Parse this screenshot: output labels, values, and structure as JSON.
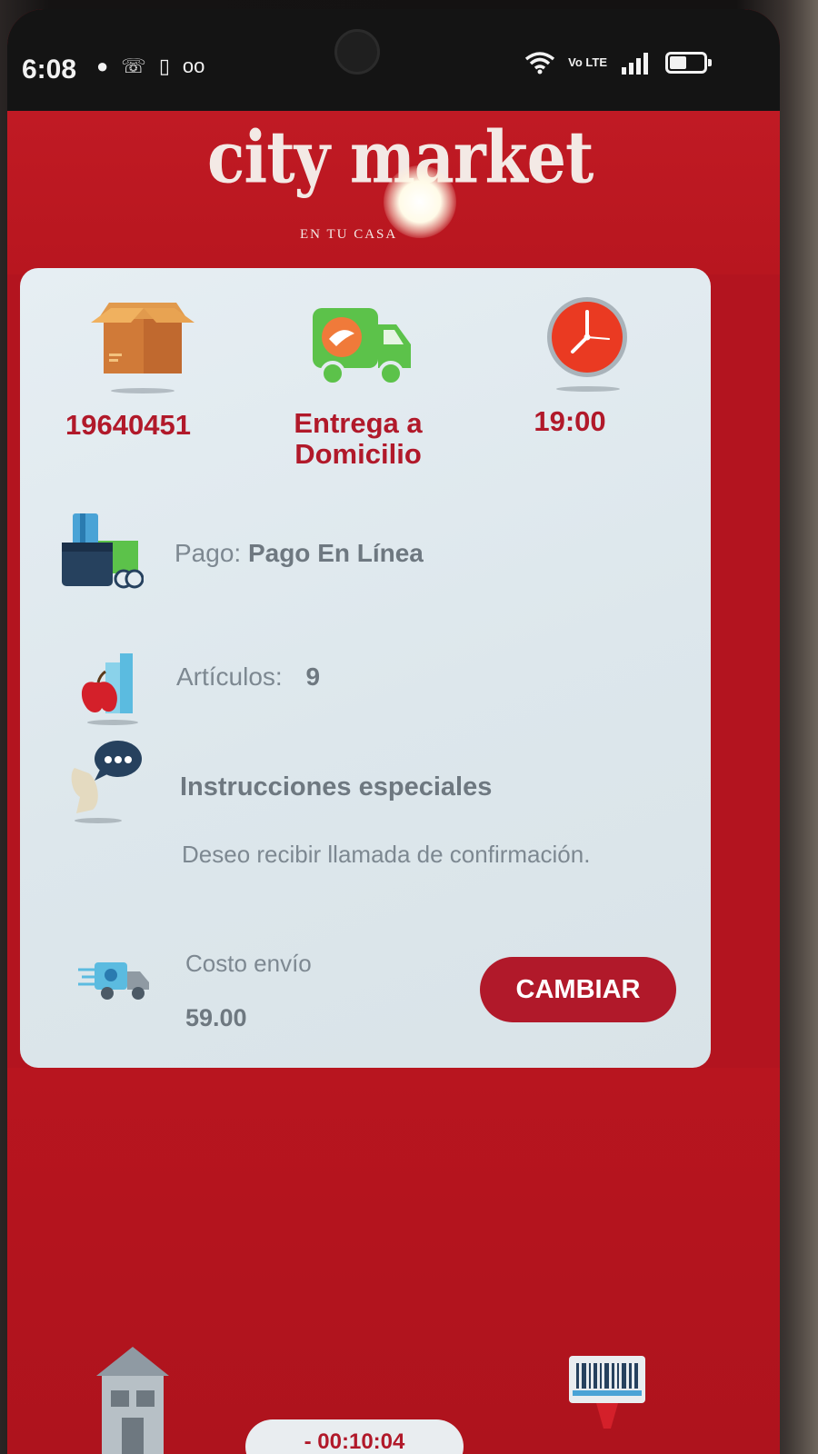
{
  "status_bar": {
    "time": "6:08",
    "network_label": "Vo LTE",
    "battery_level_percent": 55,
    "icons": [
      "message-icon",
      "missed-call-icon",
      "sim-icon",
      "voicemail-icon",
      "wifi-icon",
      "signal-icon",
      "battery-icon"
    ]
  },
  "header": {
    "logo_text": "city market",
    "tagline": "EN TU CASA"
  },
  "order": {
    "number": "19640451",
    "delivery_line1": "Entrega a",
    "delivery_line2": "Domicilio",
    "time": "19:00",
    "payment_label": "Pago:",
    "payment_value": "Pago En Línea",
    "items_label": "Artículos:",
    "items_value": "9",
    "instructions_title": "Instrucciones especiales",
    "instructions_text": "Deseo recibir llamada de confirmación.",
    "shipping_label": "Costo envío",
    "shipping_value": "59.00",
    "change_button": "CAMBIAR"
  },
  "bottom": {
    "timer": "- 00:10:04"
  },
  "colors": {
    "brand_red": "#b1192a",
    "card_bg": "#e3ebf0",
    "muted_text": "#7d8891"
  }
}
